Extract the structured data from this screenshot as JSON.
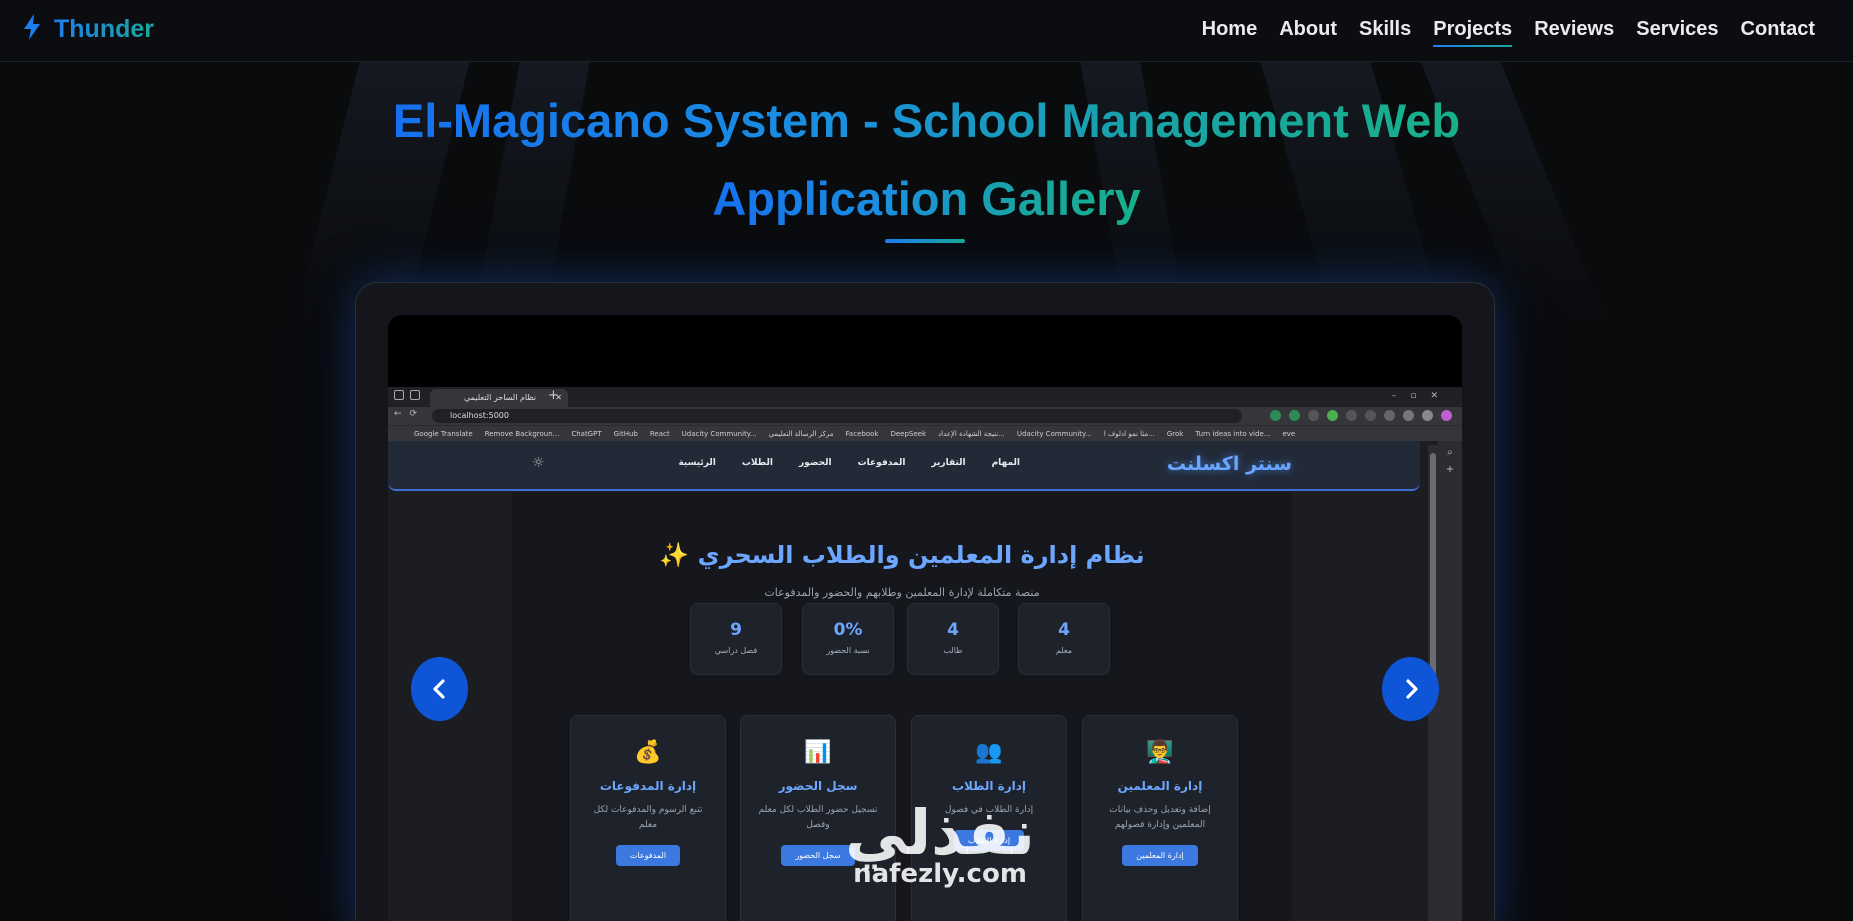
{
  "brand": {
    "name": "Thunder",
    "icon": "lightning-icon"
  },
  "nav": {
    "items": [
      {
        "label": "Home",
        "active": false
      },
      {
        "label": "About",
        "active": false
      },
      {
        "label": "Skills",
        "active": false
      },
      {
        "label": "Projects",
        "active": true
      },
      {
        "label": "Reviews",
        "active": false
      },
      {
        "label": "Services",
        "active": false
      },
      {
        "label": "Contact",
        "active": false
      }
    ]
  },
  "page": {
    "title_line1": "El-Magicano System - School Management Web",
    "title_line2": "Application Gallery"
  },
  "colors": {
    "accent_blue": "#1e7ef0",
    "accent_teal": "#1aa99a",
    "arrow_blue": "#0f55d8",
    "background": "#0a0b0d"
  },
  "screenshot": {
    "browser": {
      "tab_title": "نظام الساحر التعليمي",
      "url": "localhost:5000",
      "bookmarks": [
        "Google Translate",
        "Remove Backgroun...",
        "ChatGPT",
        "GitHub",
        "React",
        "Udacity Community...",
        "مركز الرسالة التعليمي",
        "Facebook",
        "DeepSeek",
        "نتيجة الشهادة الإعداد...",
        "Udacity Community...",
        "مثا نمو ادلوف ا...",
        "Grok",
        "Turn ideas into vide...",
        "eve"
      ]
    },
    "app": {
      "brand": "سنتر اكسلنت",
      "links": [
        "الرئيسية",
        "الطلاب",
        "الحضور",
        "المدفوعات",
        "التقارير",
        "المهام"
      ],
      "heading": "نظام إدارة المعلمين والطلاب السحري ✨",
      "subtitle": "منصة متكاملة لإدارة المعلمين وطلابهم والحضور والمدفوعات",
      "stats": [
        {
          "value": "4",
          "label": "معلم"
        },
        {
          "value": "4",
          "label": "طالب"
        },
        {
          "value": "0%",
          "label": "نسبة الحضور"
        },
        {
          "value": "9",
          "label": "فصل دراسي"
        }
      ],
      "cards": [
        {
          "icon": "👨‍🏫",
          "title": "إدارة المعلمين",
          "desc": "إضافة وتعديل وحذف بيانات المعلمين وإدارة فصولهم",
          "button": "إدارة المعلمين"
        },
        {
          "icon": "👥",
          "title": "إدارة الطلاب",
          "desc": "إدارة الطلاب في فصول",
          "button": "إدارة الطلاب"
        },
        {
          "icon": "📊",
          "title": "سجل الحضور",
          "desc": "تسجيل حضور الطلاب لكل معلم وفصل",
          "button": "سجل الحضور"
        },
        {
          "icon": "💰",
          "title": "إدارة المدفوعات",
          "desc": "تتبع الرسوم والمدفوعات لكل معلم",
          "button": "المدفوعات"
        }
      ]
    }
  },
  "watermark": {
    "arabic": "نفذلي",
    "latin": "nafezly.com"
  }
}
